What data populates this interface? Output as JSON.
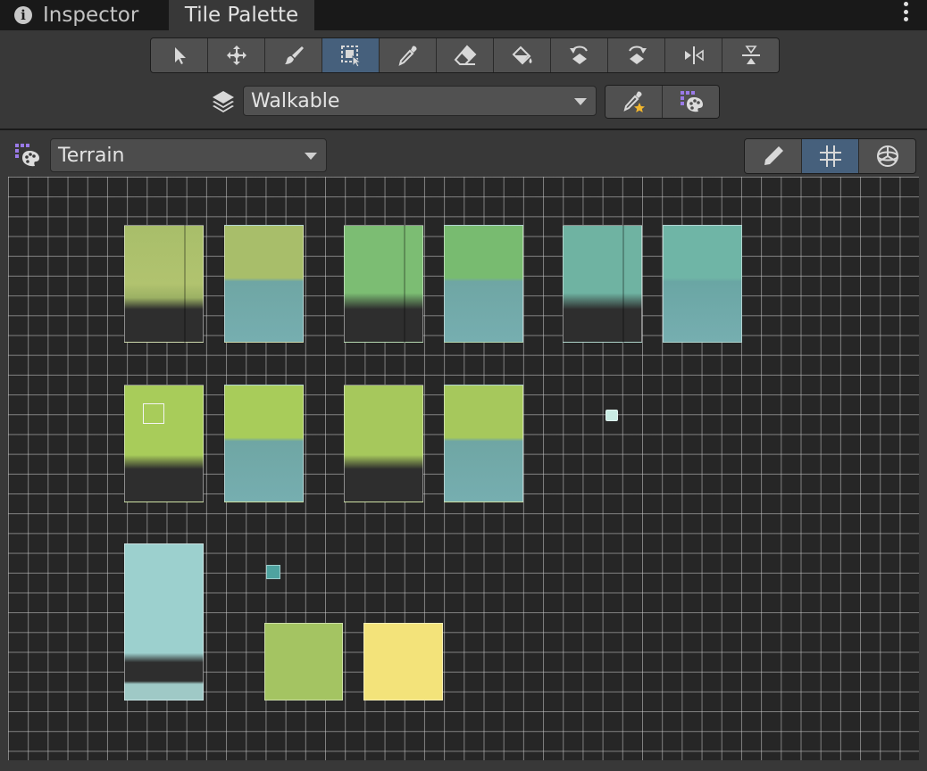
{
  "tabs": {
    "inspector_label": "Inspector",
    "tile_palette_label": "Tile Palette"
  },
  "tools": [
    {
      "name": "select-tool",
      "icon": "arrow-pointer-icon",
      "active": false
    },
    {
      "name": "move-tool",
      "icon": "move-arrows-icon",
      "active": false
    },
    {
      "name": "paint-tool",
      "icon": "paintbrush-icon",
      "active": false
    },
    {
      "name": "box-fill-tool",
      "icon": "box-fill-icon",
      "active": true
    },
    {
      "name": "pick-tool",
      "icon": "eyedropper-icon",
      "active": false
    },
    {
      "name": "erase-tool",
      "icon": "eraser-icon",
      "active": false
    },
    {
      "name": "flood-fill-tool",
      "icon": "paint-bucket-icon",
      "active": false
    },
    {
      "name": "rotate-ccw-tool",
      "icon": "rotate-ccw-icon",
      "active": false
    },
    {
      "name": "rotate-cw-tool",
      "icon": "rotate-cw-icon",
      "active": false
    },
    {
      "name": "flip-x-tool",
      "icon": "flip-horizontal-icon",
      "active": false
    },
    {
      "name": "flip-y-tool",
      "icon": "flip-vertical-icon",
      "active": false
    }
  ],
  "active_tilemap": {
    "value": "Walkable",
    "icon": "layers-icon"
  },
  "palette": {
    "value": "Terrain",
    "icon": "palette-icon"
  },
  "accent_color": "#46607c"
}
